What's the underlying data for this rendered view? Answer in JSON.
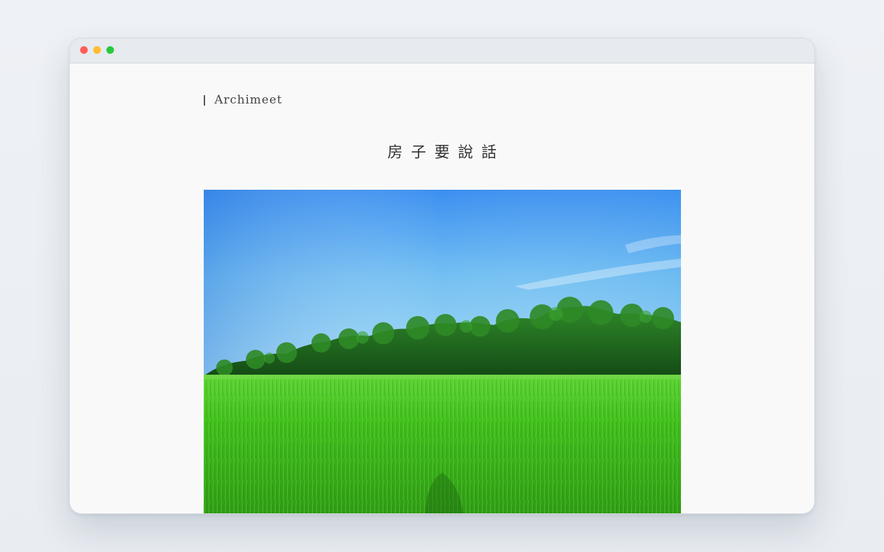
{
  "site": {
    "brand_name": "Archimeet"
  },
  "page": {
    "title": "房子要說話"
  },
  "hero_image": {
    "description_icon": "landscape-photo"
  },
  "colors": {
    "close": "#fe5f57",
    "minimize": "#febc2e",
    "maximize": "#28c840",
    "page_bg": "#f9f9f9",
    "text": "#333333"
  }
}
